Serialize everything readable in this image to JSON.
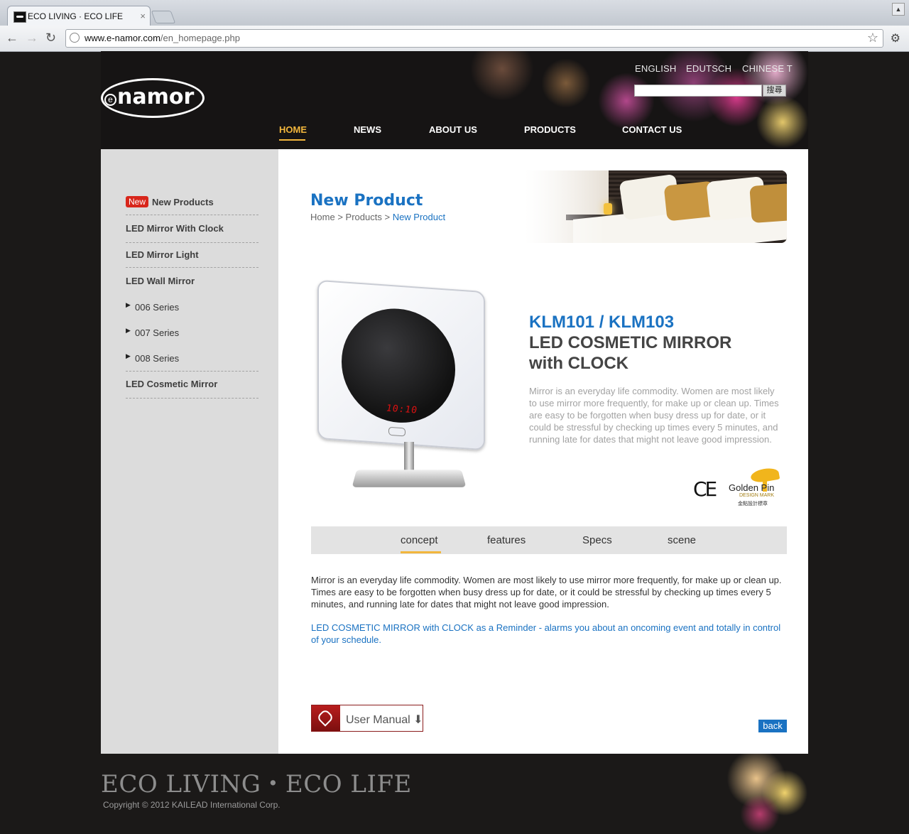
{
  "browser": {
    "tab_title": "ECO LIVING · ECO LIFE",
    "tab_close": "×",
    "url_host": "www.e-namor.com",
    "url_path": "/en_homepage.php",
    "back": "←",
    "forward": "→",
    "reload": "↻",
    "star": "☆",
    "wrench": "🔧"
  },
  "header": {
    "logo_text": "namor",
    "logo_e": "e",
    "languages": [
      "ENGLISH",
      "EDUTSCH",
      "CHINESE T"
    ],
    "search_button": "搜尋",
    "nav": [
      "HOME",
      "NEWS",
      "ABOUT US",
      "PRODUCTS",
      "CONTACT US"
    ],
    "active_nav": "HOME"
  },
  "sidebar": {
    "new_badge": "New",
    "items": [
      {
        "label": "New Products"
      },
      {
        "label": "LED Mirror With Clock"
      },
      {
        "label": "LED Mirror Light"
      },
      {
        "label": "LED Wall Mirror"
      }
    ],
    "sub_items": [
      "006 Series",
      "007 Series",
      "008 Series"
    ],
    "last_item": "LED Cosmetic Mirror",
    "arrow": "▶"
  },
  "banner": {
    "title": "New Product",
    "crumb_home": "Home",
    "crumb_sep": ">",
    "crumb_products": "Products",
    "crumb_current": "New Product"
  },
  "product": {
    "model": "KLM101 / KLM103",
    "name_line1": "LED COSMETIC MIRROR",
    "name_line2": "with CLOCK",
    "description": "Mirror is an everyday life commodity. Women are most likely to use mirror more frequently, for make up or clean up. Times are easy to be forgotten when busy dress up for date, or it could be stressful by checking up times every 5 minutes, and running late for dates that might not leave good impression.",
    "clock_time": "10:10",
    "ce_mark": "CE",
    "golden_pin": "Golden Pin",
    "golden_pin_sub": "DESIGN MARK",
    "golden_pin_cn": "金點設計標章"
  },
  "tabs": [
    "concept",
    "features",
    "Specs",
    "scene"
  ],
  "active_tab": "concept",
  "concept": {
    "body": "Mirror is an everyday life commodity. Women are most likely to use mirror more frequently, for make up or clean up. Times are easy to be forgotten when busy dress up for date, or it could be stressful by checking up times every 5 minutes, and running late for dates that might not leave good impression.",
    "highlight": "LED COSMETIC MIRROR with CLOCK as a Reminder - alarms you about an oncoming event and totally in control of your schedule."
  },
  "actions": {
    "user_manual": "User Manual ⬇",
    "back": "back"
  },
  "footer": {
    "slogan": "ECO LIVING・ECO LIFE",
    "copyright": "Copyright ©  2012 KAILEAD International Corp."
  },
  "colors": {
    "accent_blue": "#1a72c2",
    "nav_active": "#f2b63c",
    "badge_red": "#d8261b"
  }
}
